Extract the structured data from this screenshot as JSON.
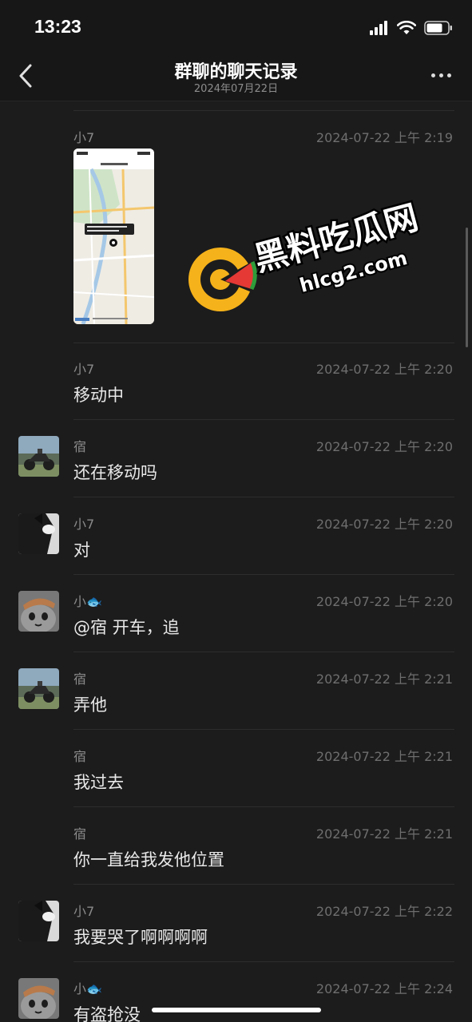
{
  "status_bar": {
    "time": "13:23"
  },
  "nav": {
    "title": "群聊的聊天记录",
    "subtitle": "2024年07月22日"
  },
  "watermark": {
    "brand": "黑料吃瓜网",
    "domain": "hlcg2.com"
  },
  "messages": [
    {
      "sender": "小7",
      "time": "2024-07-22 上午 2:19",
      "type": "image",
      "avatar": "none"
    },
    {
      "sender": "小7",
      "time": "2024-07-22 上午 2:20",
      "text": "移动中",
      "avatar": "none"
    },
    {
      "sender": "宿",
      "time": "2024-07-22 上午 2:20",
      "text": "还在移动吗",
      "avatar": "motorcycle"
    },
    {
      "sender": "小7",
      "time": "2024-07-22 上午 2:20",
      "text": "对",
      "avatar": "dark-cat"
    },
    {
      "sender": "小🐟",
      "time": "2024-07-22 上午 2:20",
      "text": "@宿 开车，追",
      "avatar": "cartoon"
    },
    {
      "sender": "宿",
      "time": "2024-07-22 上午 2:21",
      "text": "弄他",
      "avatar": "motorcycle"
    },
    {
      "sender": "宿",
      "time": "2024-07-22 上午 2:21",
      "text": "我过去",
      "avatar": "none"
    },
    {
      "sender": "宿",
      "time": "2024-07-22 上午 2:21",
      "text": "你一直给我发他位置",
      "avatar": "none"
    },
    {
      "sender": "小7",
      "time": "2024-07-22 上午 2:22",
      "text": "我要哭了啊啊啊啊",
      "avatar": "dark-cat"
    },
    {
      "sender": "小🐟",
      "time": "2024-07-22 上午 2:24",
      "text": "有盗抢没",
      "avatar": "cartoon"
    }
  ]
}
